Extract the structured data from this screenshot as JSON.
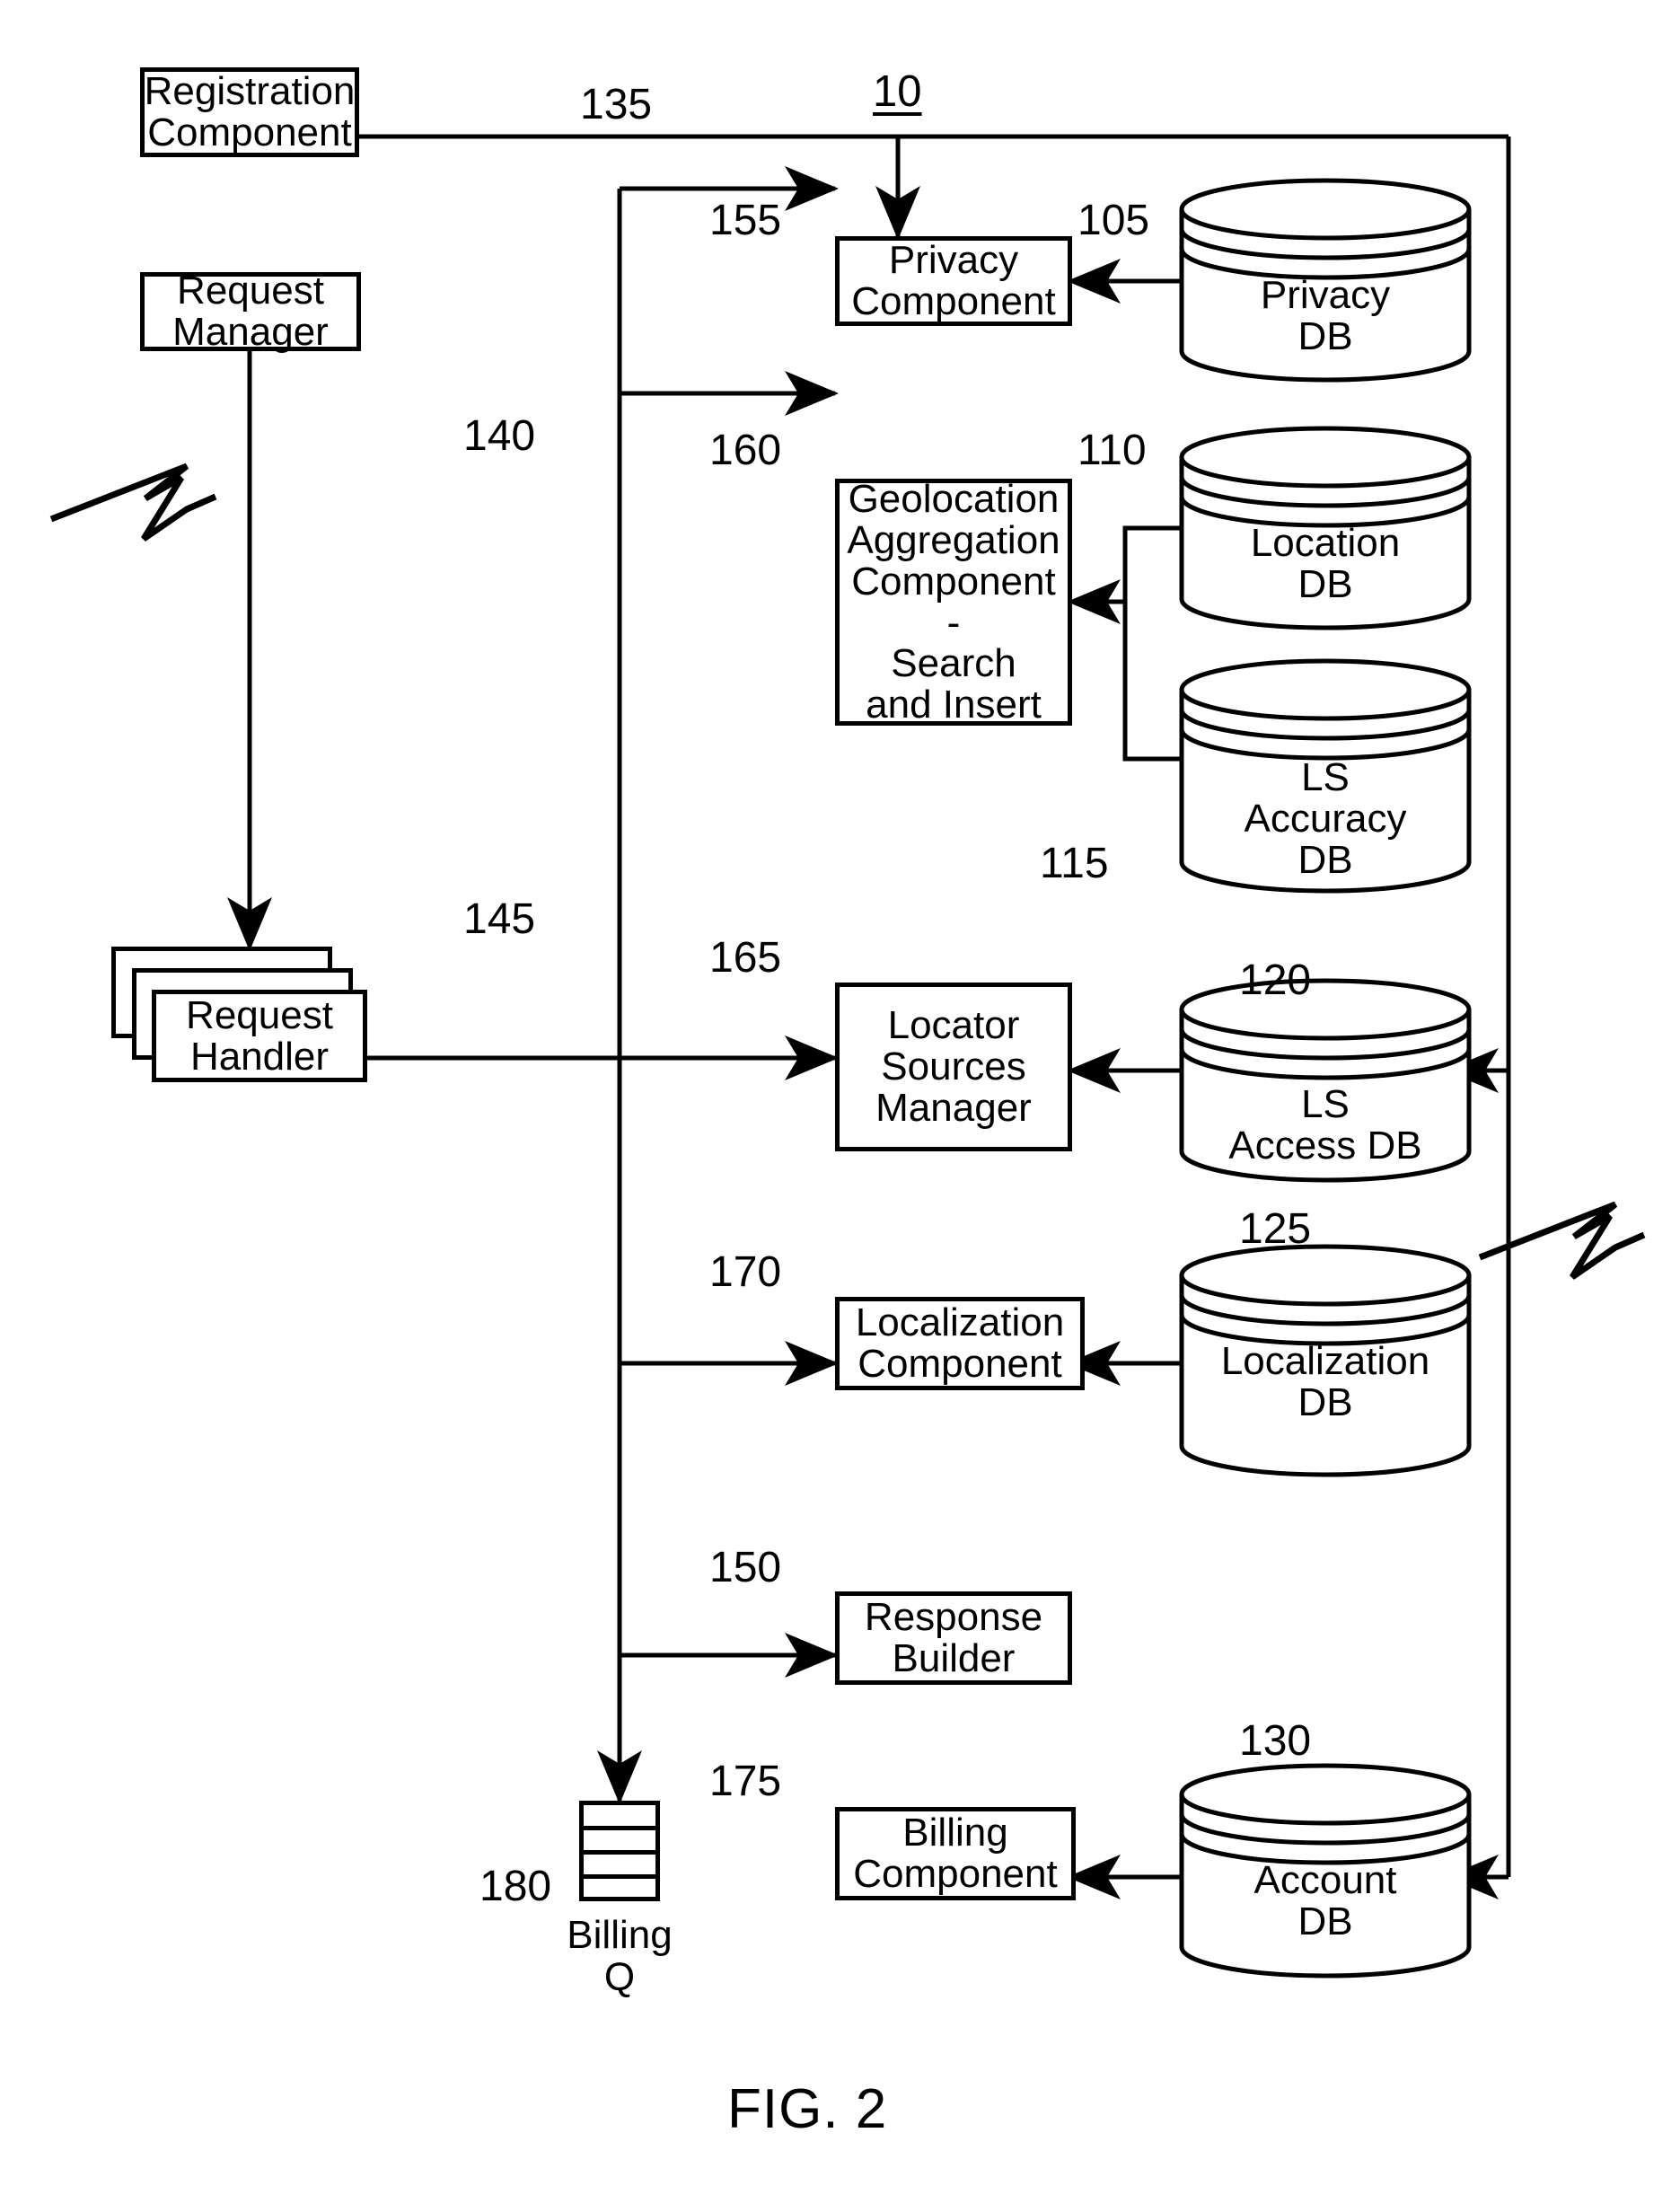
{
  "figure": {
    "caption": "FIG. 2",
    "system_id": "10"
  },
  "components": {
    "registration": {
      "label": "Registration\nComponent",
      "ref": "135"
    },
    "request_manager": {
      "label": "Request\nManager",
      "ref": "140"
    },
    "request_handler": {
      "label": "Request\nHandler",
      "ref": "145"
    },
    "privacy": {
      "label": "Privacy\nComponent",
      "ref": "155"
    },
    "geolocation": {
      "label": "Geolocation\nAggregation\nComponent -\nSearch\nand Insert",
      "ref": "160"
    },
    "locator_sources": {
      "label": "Locator\nSources\nManager",
      "ref": "165"
    },
    "localization": {
      "label": "Localization\nComponent",
      "ref": "170"
    },
    "response_builder": {
      "label": "Response\nBuilder",
      "ref": "150"
    },
    "billing": {
      "label": "Billing\nComponent",
      "ref": "175"
    }
  },
  "databases": {
    "privacy_db": {
      "label": "Privacy\nDB",
      "ref": "105"
    },
    "location_db": {
      "label": "Location\nDB",
      "ref": "110"
    },
    "ls_accuracy_db": {
      "label": "LS\nAccuracy\nDB",
      "ref": "115"
    },
    "ls_access_db": {
      "label": "LS\nAccess DB",
      "ref": "120"
    },
    "localization_db": {
      "label": "Localization\nDB",
      "ref": "125"
    },
    "account_db": {
      "label": "Account\nDB",
      "ref": "130"
    }
  },
  "queues": {
    "billing_queue": {
      "label": "Billing\nQ",
      "ref": "180"
    }
  },
  "colors": {
    "ink": "#000000",
    "paper": "#ffffff"
  }
}
